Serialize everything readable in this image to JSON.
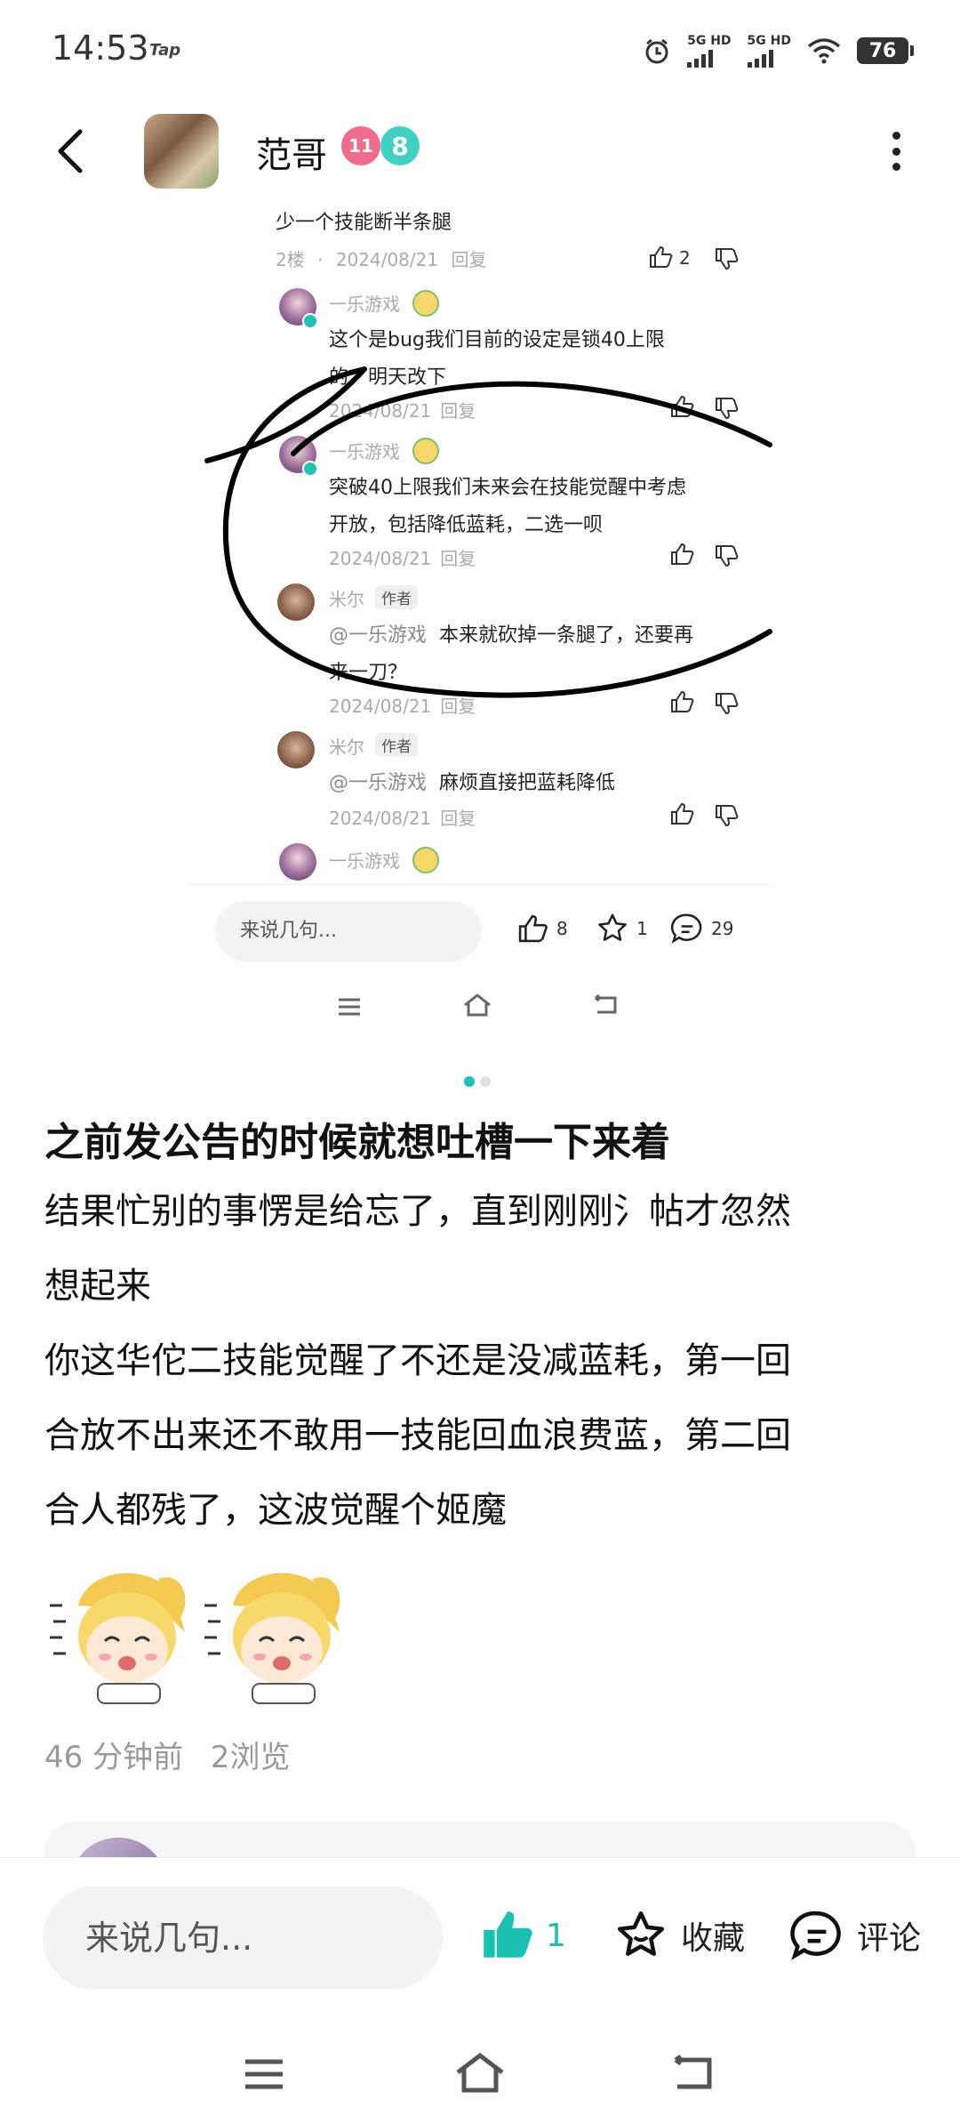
{
  "status_bar": {
    "time": "14:53",
    "tap_label": "Tap",
    "signal1_label": "5G HD",
    "signal2_label": "5G HD",
    "battery": "76"
  },
  "header": {
    "name": "范哥",
    "vip_badge": "11",
    "level_badge": "8"
  },
  "embedded": {
    "top_comment_text": "少一个技能断半条腿",
    "top_comment_floor": "2楼",
    "top_comment_sep": "·",
    "top_comment_date": "2024/08/21",
    "top_comment_reply": "回复",
    "top_comment_likes": "2",
    "replies": [
      {
        "user": "一乐游戏",
        "text1": "这个是bug我们目前的设定是锁40上限",
        "text2": "的，明天改下",
        "date": "2024/08/21",
        "reply": "回复"
      },
      {
        "user": "一乐游戏",
        "text1": "突破40上限我们未来会在技能觉醒中考虑",
        "text2": "开放，包括降低蓝耗，二选一呗",
        "date": "2024/08/21",
        "reply": "回复"
      },
      {
        "user": "米尔",
        "tag": "作者",
        "mention": "@一乐游戏",
        "text1": "本来就砍掉一条腿了，还要再",
        "text2": "来一刀？",
        "date": "2024/08/21",
        "reply": "回复"
      },
      {
        "user": "米尔",
        "tag": "作者",
        "mention": "@一乐游戏",
        "text1": "麻烦直接把蓝耗降低",
        "date": "2024/08/21",
        "reply": "回复"
      },
      {
        "user": "一乐游戏"
      }
    ],
    "input_placeholder": "来说几句...",
    "likes": "8",
    "favorites": "1",
    "comments": "29"
  },
  "post": {
    "title": "之前发公告的时候就想吐槽一下来着",
    "lines": [
      "结果忙别的事愣是给忘了，直到刚刚氵帖才忽然",
      "想起来",
      "你这华佗二技能觉醒了不还是没减蓝耗，第一回",
      "合放不出来还不敢用一技能回血浪费蓝，第二回",
      "合人都残了，这波觉醒个姬魔"
    ],
    "time_ago": "46 分钟前",
    "views": "2浏览"
  },
  "bottom_bar": {
    "input_placeholder": "来说几句...",
    "like_count": "1",
    "favorite_label": "收藏",
    "comment_label": "评论"
  },
  "colors": {
    "accent": "#19c2b0",
    "text": "#111111",
    "muted": "#999999"
  }
}
